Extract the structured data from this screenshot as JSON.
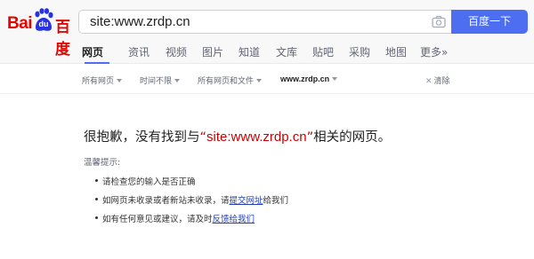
{
  "logo": {
    "bai": "Bai",
    "du": "du",
    "cn": "百度"
  },
  "search": {
    "query": "site:www.zrdp.cn",
    "button_label": "百度一下",
    "camera_icon": "camera-icon"
  },
  "tabs": [
    {
      "label": "网页",
      "active": true
    },
    {
      "label": "资讯",
      "active": false
    },
    {
      "label": "视频",
      "active": false
    },
    {
      "label": "图片",
      "active": false
    },
    {
      "label": "知道",
      "active": false
    },
    {
      "label": "文库",
      "active": false
    },
    {
      "label": "贴吧",
      "active": false
    },
    {
      "label": "采购",
      "active": false
    },
    {
      "label": "地图",
      "active": false
    },
    {
      "label": "更多»",
      "active": false
    }
  ],
  "filters": {
    "all_pages": "所有网页",
    "time": "时间不限",
    "file_type": "所有网页和文件",
    "site": "www.zrdp.cn",
    "clear": "清除"
  },
  "result": {
    "prefix": "很抱歉，没有找到与",
    "open_quote": "“",
    "keyword": "site:www.zrdp.cn",
    "close_quote": "”",
    "suffix": "相关的网页。"
  },
  "tips": {
    "title": "温馨提示:",
    "tip1": "请检查您的输入是否正确",
    "tip2_prefix": "如网页未收录或者新站未收录，请",
    "tip2_link": "提交网址",
    "tip2_suffix": "给我们",
    "tip3_prefix": "如有任何意见或建议，请及时",
    "tip3_link": "反馈给我们"
  },
  "colors": {
    "brand_red": "#e10601",
    "brand_blue": "#4e6ef2",
    "link": "#2440b3",
    "highlight": "#cc0000"
  }
}
